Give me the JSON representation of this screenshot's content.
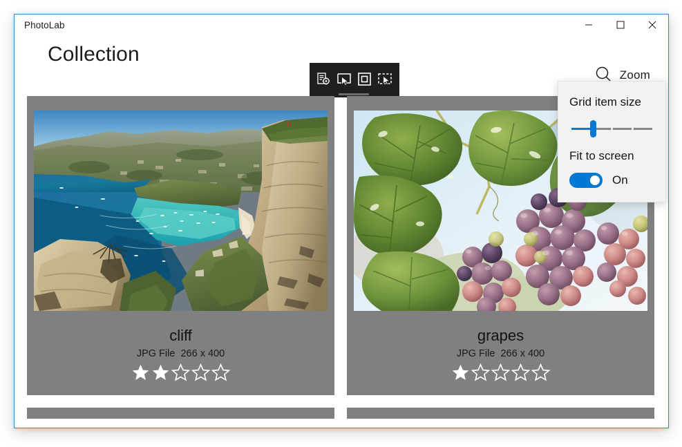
{
  "window": {
    "title": "PhotoLab",
    "caption_buttons": [
      {
        "name": "minimize",
        "glyph": "minimize-icon",
        "label": "Minimize"
      },
      {
        "name": "maximize",
        "glyph": "maximize-icon",
        "label": "Maximize"
      },
      {
        "name": "close",
        "glyph": "close-icon",
        "label": "Close"
      }
    ]
  },
  "header": {
    "page_title": "Collection",
    "zoom_button_label": "Zoom",
    "zoom_icon": "search-icon"
  },
  "command_bar": {
    "background": "#1f1f1f",
    "selected_index": 1,
    "items": [
      {
        "icon": "edit-target-icon",
        "label": "Edit"
      },
      {
        "icon": "select-pointer-icon",
        "label": "Select"
      },
      {
        "icon": "square-outline-icon",
        "label": "Frame"
      },
      {
        "icon": "select-all-icon",
        "label": "Select all"
      }
    ]
  },
  "zoom_flyout": {
    "visible": true,
    "grid_item_size_label": "Grid item size",
    "slider": {
      "value": 25,
      "min": 0,
      "max": 100,
      "steps": 4,
      "accent": "#0078d4",
      "track": "#868686"
    },
    "fit_to_screen_label": "Fit to screen",
    "toggle": {
      "state_label": "On",
      "checked": true,
      "accent": "#0078d4"
    }
  },
  "grid": {
    "card_background": "#808080",
    "cards": [
      {
        "name": "cliff",
        "file_type": "JPG File",
        "dimensions": "266 x 400",
        "rating": 2,
        "max_rating": 5,
        "image": "coastal-cliff-bay-photo"
      },
      {
        "name": "grapes",
        "file_type": "JPG File",
        "dimensions": "266 x 400",
        "rating": 1,
        "max_rating": 5,
        "image": "grape-vine-photo"
      }
    ],
    "partial_row_stubs": 2
  },
  "theme": {
    "accent": "#0078d4",
    "window_border": "#3a82c4",
    "text_primary": "#1c1c1c",
    "flyout_background": "#f2f2f2"
  }
}
